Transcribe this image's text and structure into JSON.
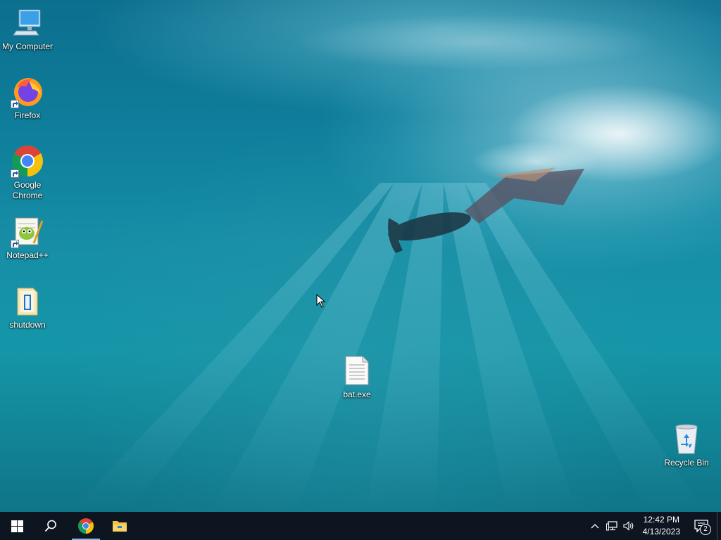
{
  "desktop": {
    "icons": [
      {
        "label": "My Computer",
        "icon": "computer-icon",
        "shortcut": false
      },
      {
        "label": "Firefox",
        "icon": "firefox-icon",
        "shortcut": true
      },
      {
        "label": "Google Chrome",
        "icon": "chrome-icon",
        "shortcut": true
      },
      {
        "label": "Notepad++",
        "icon": "notepadpp-icon",
        "shortcut": true
      },
      {
        "label": "shutdown",
        "icon": "batch-file-icon",
        "shortcut": false
      },
      {
        "label": "bat.exe",
        "icon": "text-file-icon",
        "shortcut": false
      },
      {
        "label": "Recycle Bin",
        "icon": "recycle-bin-icon",
        "shortcut": false
      }
    ]
  },
  "taskbar": {
    "start_icon": "windows-logo-icon",
    "search_icon": "search-icon",
    "pinned": [
      {
        "name": "chrome",
        "icon": "chrome-icon",
        "active": true
      },
      {
        "name": "file-explorer",
        "icon": "folder-icon",
        "active": false
      }
    ],
    "tray": {
      "icons": [
        "chevron-up-icon",
        "network-icon",
        "volume-icon"
      ],
      "time": "12:42 PM",
      "date": "4/13/2023",
      "notifications": "2"
    }
  },
  "colors": {
    "taskbar_bg": "#0d1620",
    "wallpaper_mid": "#178ea6"
  }
}
